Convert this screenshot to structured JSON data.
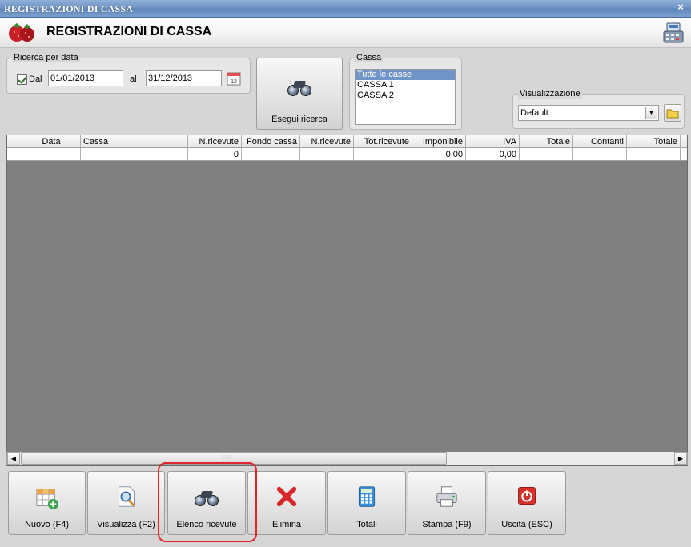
{
  "window": {
    "title": "REGISTRAZIONI DI CASSA",
    "close_label": "×"
  },
  "header": {
    "title": "REGISTRAZIONI DI CASSA"
  },
  "date_search": {
    "legend": "Ricerca per data",
    "from_label": "Dal",
    "from_value": "01/01/2013",
    "to_label": "al",
    "to_value": "31/12/2013"
  },
  "search_button": {
    "label": "Esegui ricerca"
  },
  "cassa": {
    "legend": "Cassa",
    "options": [
      {
        "label": "Tutte le casse",
        "selected": true
      },
      {
        "label": "CASSA 1",
        "selected": false
      },
      {
        "label": "CASSA 2",
        "selected": false
      }
    ]
  },
  "view": {
    "legend": "Visualizzazione",
    "value": "Default"
  },
  "grid": {
    "columns": [
      "",
      "Data",
      "Cassa",
      "N.ricevute",
      "Fondo cassa",
      "N.ricevute",
      "Tot.ricevute",
      "Imponibile",
      "IVA",
      "Totale",
      "Contanti",
      "Totale"
    ],
    "row": [
      "",
      "",
      "",
      "0",
      "",
      "",
      "",
      "0,00",
      "0,00",
      "",
      "",
      ""
    ],
    "scroll_grip": "::::::"
  },
  "toolbar": {
    "buttons": [
      {
        "label": "Nuovo (F4)",
        "icon": "grid-add-icon"
      },
      {
        "label": "Visualizza (F2)",
        "icon": "document-search-icon"
      },
      {
        "label": "Elenco ricevute",
        "icon": "binoculars-icon"
      },
      {
        "label": "Elimina",
        "icon": "red-x-icon"
      },
      {
        "label": "Totali",
        "icon": "calculator-icon"
      },
      {
        "label": "Stampa (F9)",
        "icon": "printer-icon"
      },
      {
        "label": "Uscita (ESC)",
        "icon": "power-icon"
      }
    ]
  },
  "colors": {
    "title_bar": "#6d92c4",
    "selection": "#6f95c8",
    "highlight": "#e0242a"
  }
}
